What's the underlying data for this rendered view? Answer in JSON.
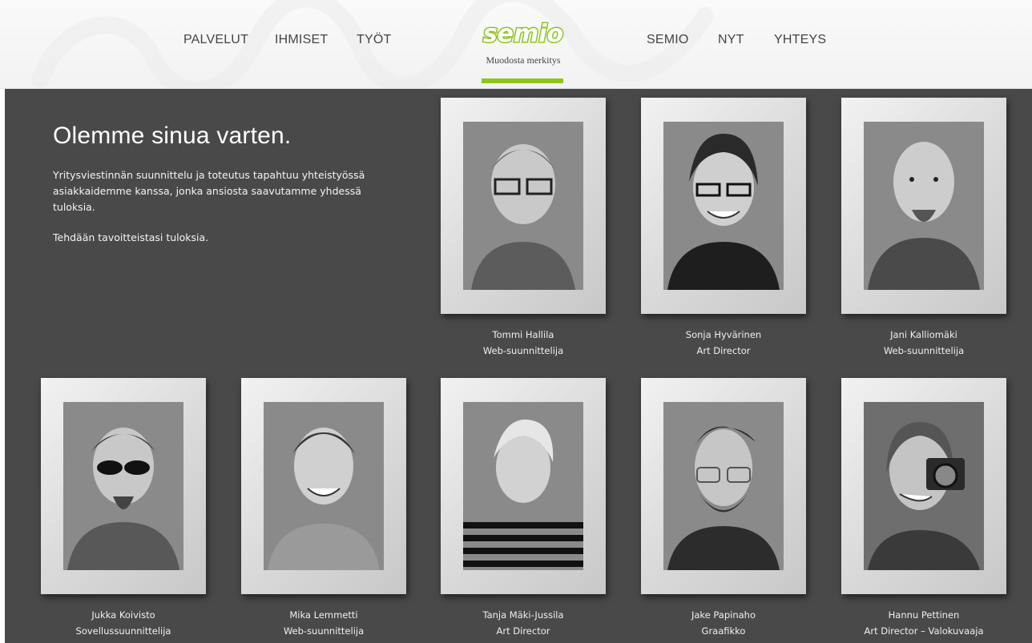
{
  "nav": {
    "left": [
      "PALVELUT",
      "IHMISET",
      "TYÖT"
    ],
    "right": [
      "SEMIO",
      "NYT",
      "YHTEYS"
    ]
  },
  "logo": {
    "text": "semio",
    "tagline": "Muodosta merkitys"
  },
  "intro": {
    "heading": "Olemme sinua varten.",
    "paragraph1": "Yritysviestinnän suunnittelu ja toteutus tapahtuu yhteistyössä asiakkaidemme kanssa, jonka ansiosta saavutamme yhdessä tuloksia.",
    "paragraph2": "Tehdään tavoitteistasi tuloksia."
  },
  "people": [
    {
      "name": "Tommi Hallila",
      "role": "Web-suunnittelija"
    },
    {
      "name": "Sonja Hyvärinen",
      "role": "Art Director"
    },
    {
      "name": "Jani Kalliomäki",
      "role": "Web-suunnittelija"
    },
    {
      "name": "Jukka Koivisto",
      "role": "Sovellussuunnittelija"
    },
    {
      "name": "Mika Lemmetti",
      "role": "Web-suunnittelija"
    },
    {
      "name": "Tanja Mäki-Jussila",
      "role": "Art Director"
    },
    {
      "name": "Jake Papinaho",
      "role": "Graafikko"
    },
    {
      "name": "Hannu Pettinen",
      "role": "Art Director – Valokuvaaja"
    }
  ],
  "colors": {
    "accent": "#8fc31f",
    "panel": "#4a4949",
    "nav_text": "#444444"
  }
}
